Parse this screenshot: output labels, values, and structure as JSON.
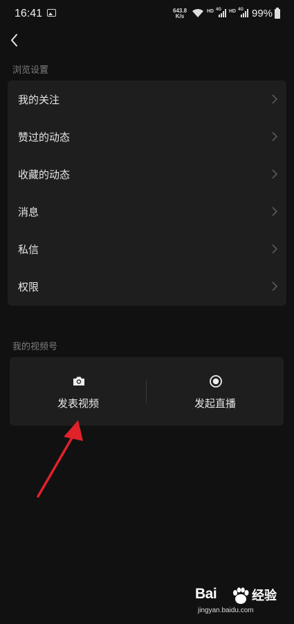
{
  "status_bar": {
    "time": "16:41",
    "speed_value": "643.8",
    "speed_unit": "K/s",
    "net1": "HD",
    "net1_gen": "4G",
    "net2": "HD",
    "net2_gen": "4G",
    "battery": "99%"
  },
  "browse_settings": {
    "title": "浏览设置",
    "items": [
      {
        "label": "我的关注"
      },
      {
        "label": "赞过的动态"
      },
      {
        "label": "收藏的动态"
      },
      {
        "label": "消息"
      },
      {
        "label": "私信"
      },
      {
        "label": "权限"
      }
    ]
  },
  "my_channel": {
    "title": "我的视频号",
    "publish_video": "发表视频",
    "start_live": "发起直播"
  },
  "watermark": {
    "brand": "Bai",
    "product": "经验",
    "url": "jingyan.baidu.com"
  },
  "colors": {
    "background": "#111111",
    "card": "#1e1e1e",
    "arrow": "#e0222a"
  }
}
